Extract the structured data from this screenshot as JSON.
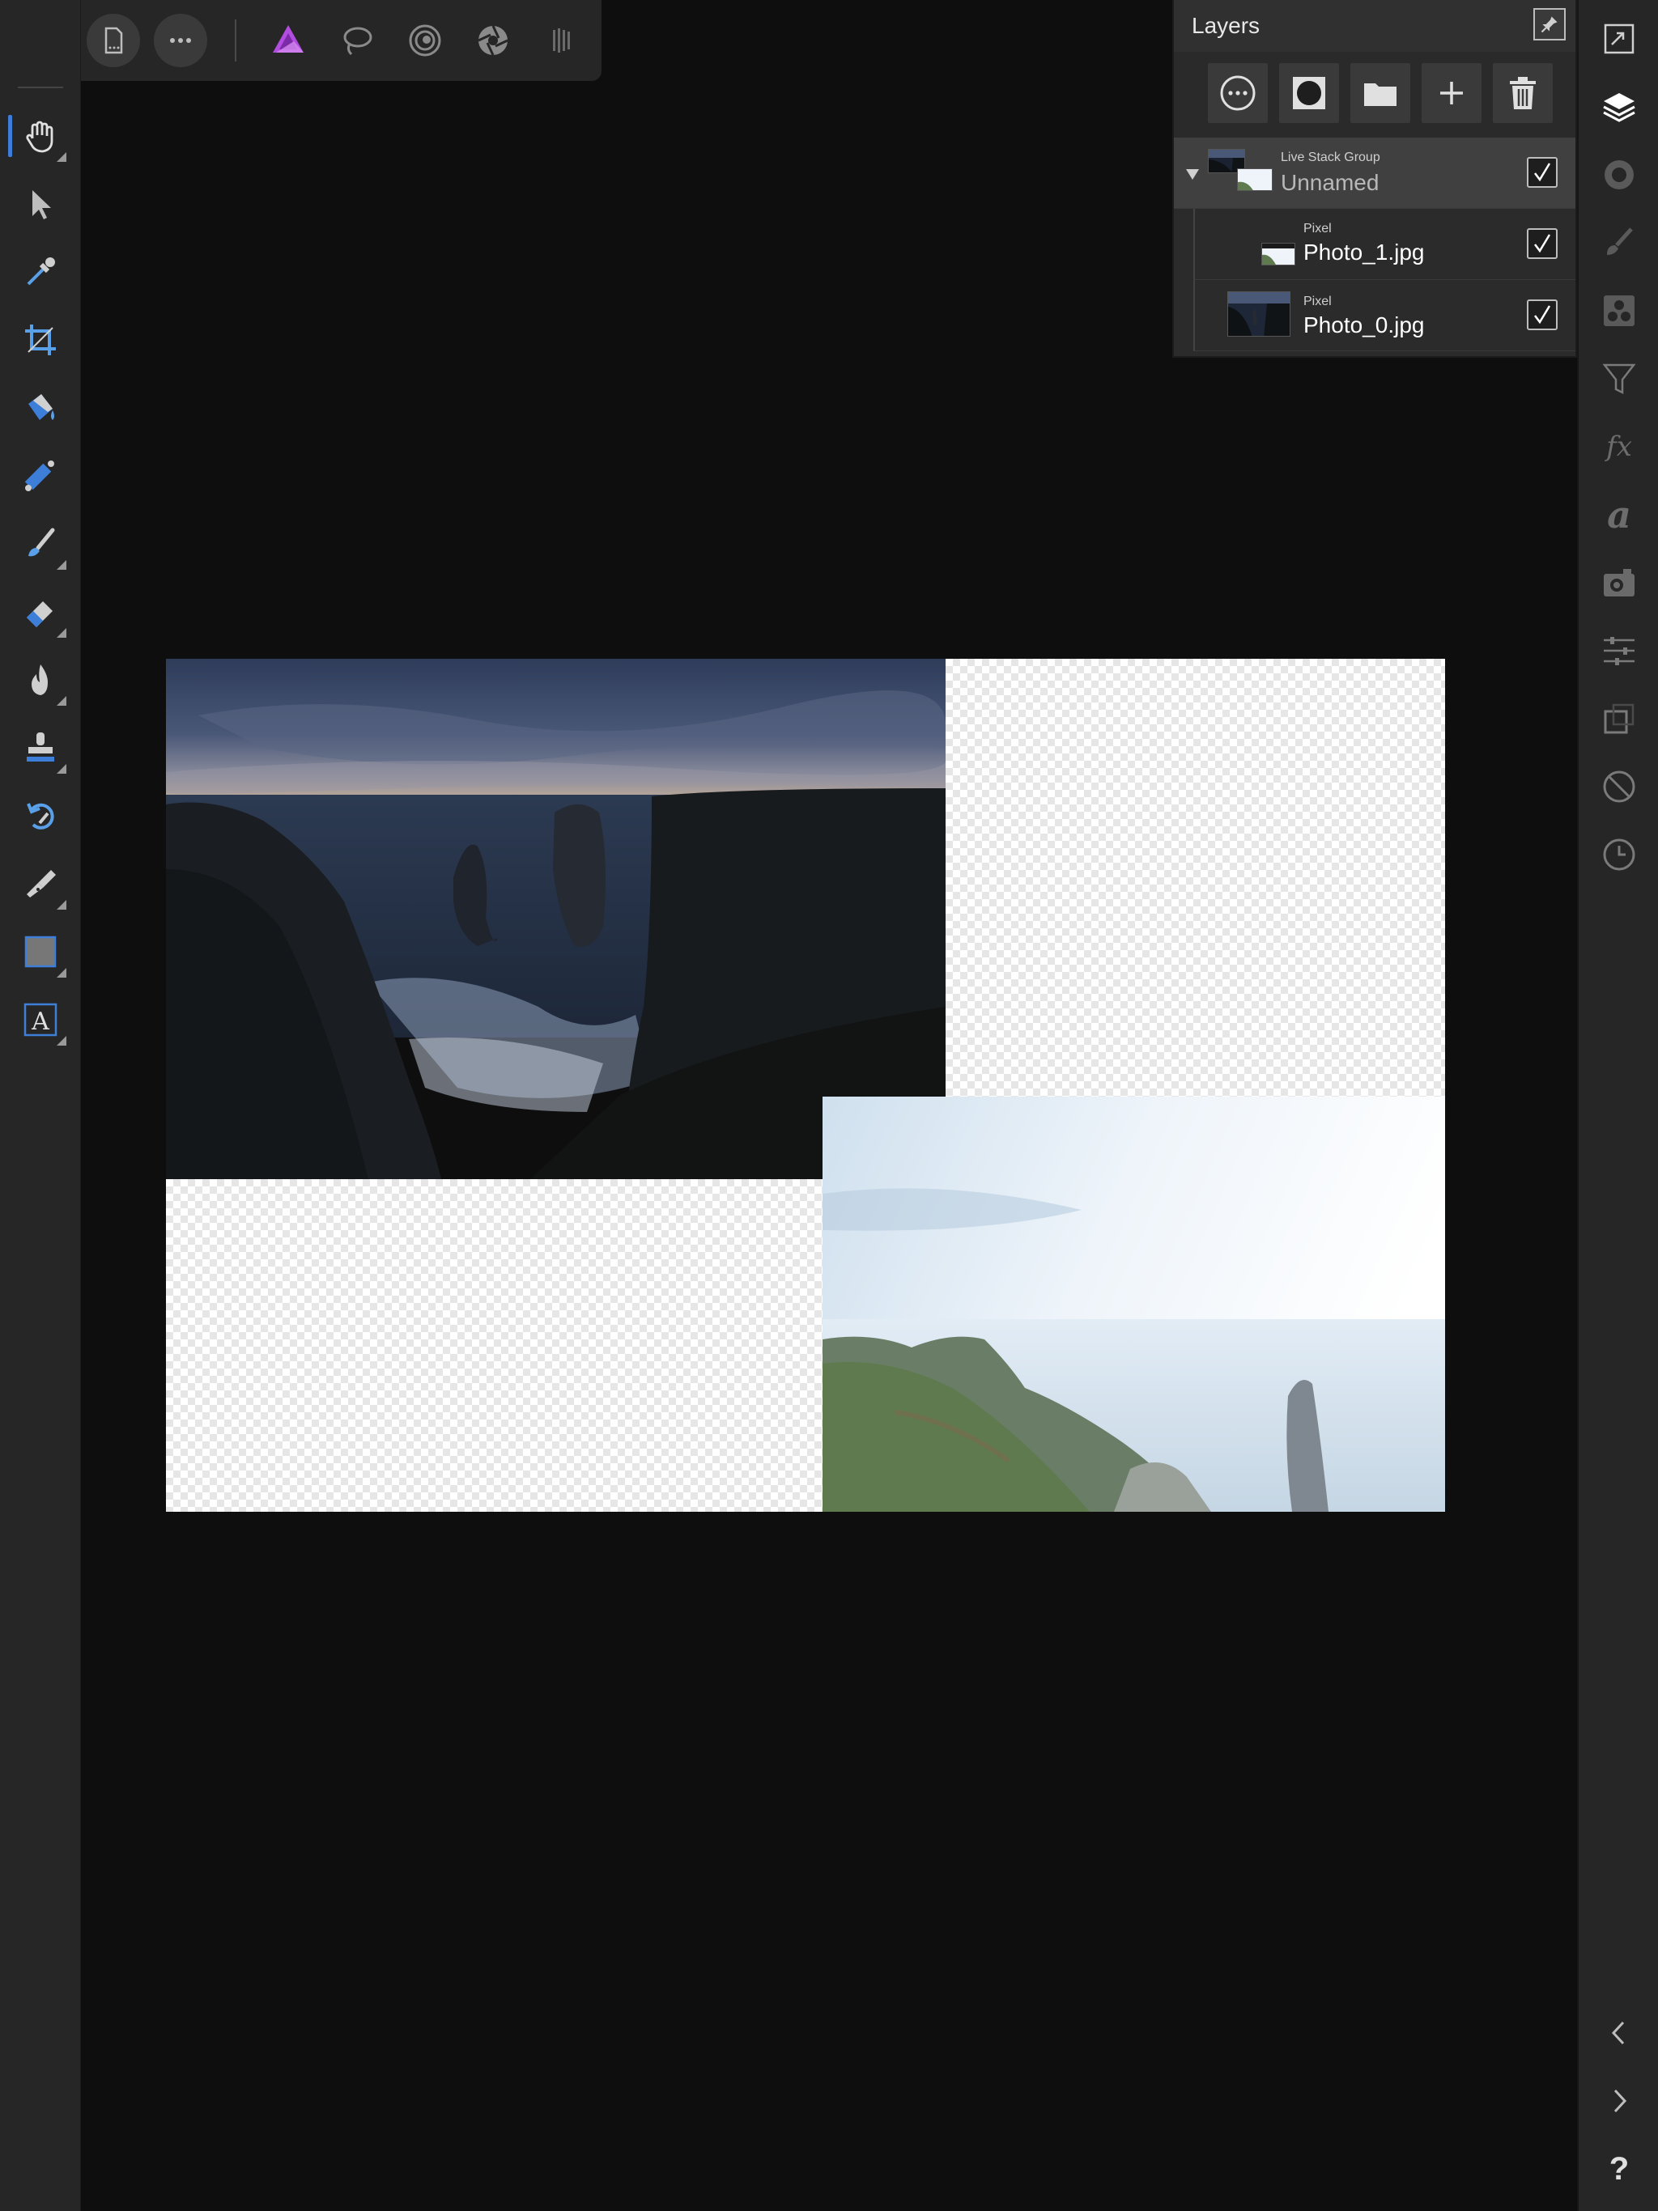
{
  "layers_panel": {
    "title": "Layers",
    "layers": [
      {
        "type": "Live Stack Group",
        "name": "Unnamed",
        "visible": true,
        "expanded": true
      },
      {
        "type": "Pixel",
        "name": "Photo_1.jpg",
        "visible": true
      },
      {
        "type": "Pixel",
        "name": "Photo_0.jpg",
        "visible": true
      }
    ]
  },
  "right_bar": {
    "fx_label": "fx",
    "text_styles_label": "a",
    "help_label": "?"
  },
  "text_tool_glyph": "A",
  "colors": {
    "accent": "#3d7ed8",
    "affinity_purple": "#b34de0",
    "panel_bg": "#2b2b2b",
    "toolbar_bg": "#262626",
    "canvas_bg": "#0e0e0e"
  }
}
